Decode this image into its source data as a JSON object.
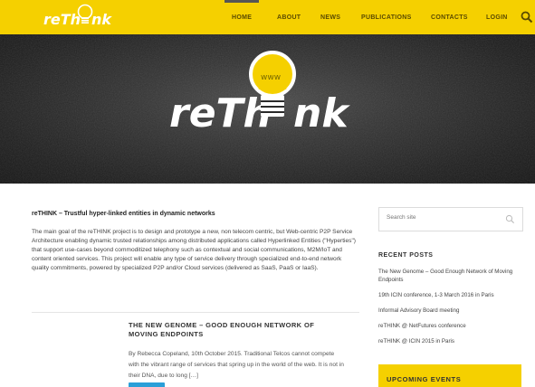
{
  "brand": {
    "logo_text": "reThink",
    "hero_text": "reThink"
  },
  "nav": {
    "items": [
      {
        "label": "HOME",
        "active": true
      },
      {
        "label": "ABOUT",
        "active": false
      },
      {
        "label": "NEWS",
        "active": false
      },
      {
        "label": "PUBLICATIONS",
        "active": false
      },
      {
        "label": "CONTACTS",
        "active": false
      },
      {
        "label": "LOGIN",
        "active": false
      }
    ],
    "search_icon": "search-icon"
  },
  "intro": {
    "title": "reTHINK – Trustful hyper-linked entities in dynamic networks",
    "text": "The main goal of the reTHINK project is to design and prototype a new, non telecom centric, but Web-centric P2P Service Architecture enabling dynamic trusted relationships among distributed applications called Hyperlinked Entities (\"Hyperties\") that support use-cases beyond commoditized telephony such as contextual and social communications, M2M/IoT and content oriented services. This project will enable any type of service delivery through specialized end-to-end network quality commitments, powered by specialized P2P and/or Cloud services (delivered as SaaS, PaaS or IaaS)."
  },
  "post": {
    "title": "THE NEW GENOME – GOOD ENOUGH NETWORK OF MOVING ENDPOINTS",
    "excerpt": "By Rebecca Copeland, 10th October 2015. Traditional Telcos cannot compete with the vibrant range of services that spring up in the world of the web. It is not in their DNA, due to long […]"
  },
  "sidebar": {
    "search_placeholder": "Search site",
    "recent_heading": "RECENT POSTS",
    "recent_posts": [
      "The New Genome – Good Enough Network of Moving Endpoints",
      "19th ICIN conference, 1-3 March 2016 in Paris",
      "Informal Advisory Board meeting",
      "reTHINK @ NetFutures conference",
      "reTHINK @ ICIN 2015 in Paris"
    ],
    "events_heading": "UPCOMING EVENTS"
  },
  "colors": {
    "brand_yellow": "#f5d000",
    "link_blue": "#2a9fd8"
  }
}
